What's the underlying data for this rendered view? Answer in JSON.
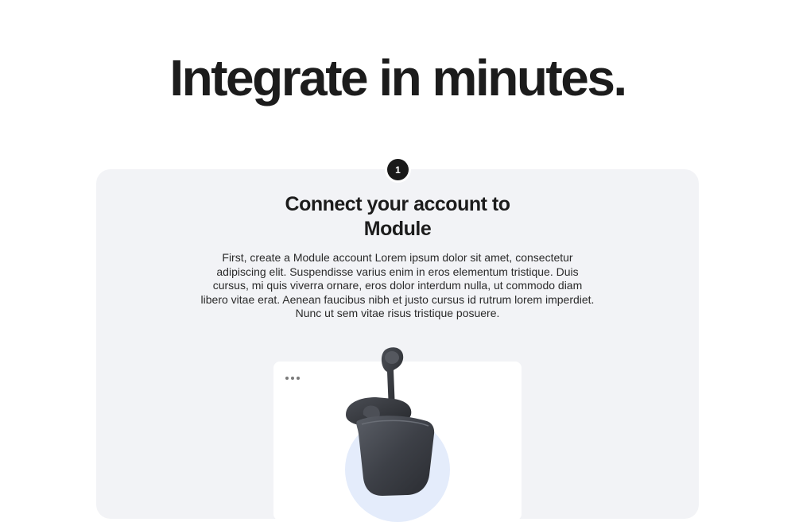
{
  "hero": {
    "title": "Integrate in minutes."
  },
  "step": {
    "number": "1",
    "title": "Connect your account to Module",
    "description": "First, create a Module account Lorem ipsum dolor sit amet, consectetur adipiscing elit. Suspendisse varius enim in eros elementum tristique. Duis cursus, mi quis viverra ornare, eros dolor interdum nulla, ut commodo diam libero vitae erat. Aenean faucibus nibh et justo cursus id rutrum lorem imperdiet. Nunc ut sem vitae risus tristique posuere."
  },
  "preview": {
    "menu_icon": "more-dots-icon",
    "image": "earbuds-case-product-image"
  },
  "colors": {
    "card_background": "#f2f3f6",
    "badge": "#1a1a1a",
    "accent_circle": "#e4ecfb"
  }
}
